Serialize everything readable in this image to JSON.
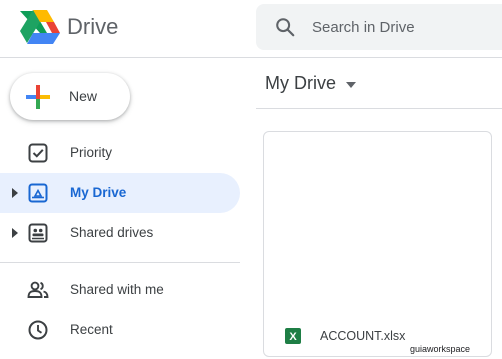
{
  "header": {
    "brand": "Drive",
    "search_placeholder": "Search in Drive"
  },
  "sidebar": {
    "new_label": "New",
    "items": [
      {
        "label": "Priority",
        "icon": "priority-icon",
        "active": false
      },
      {
        "label": "My Drive",
        "icon": "my-drive-icon",
        "active": true
      },
      {
        "label": "Shared drives",
        "icon": "shared-drives-icon",
        "active": false
      },
      {
        "label": "Shared with me",
        "icon": "shared-with-me-icon",
        "active": false
      },
      {
        "label": "Recent",
        "icon": "recent-icon",
        "active": false
      }
    ]
  },
  "main": {
    "title": "My Drive",
    "files": [
      {
        "name": "ACCOUNT.xlsx",
        "type": "excel-icon"
      }
    ]
  },
  "watermark": "guiaworkspace",
  "colors": {
    "active_bg": "#e8f0fe",
    "active_text": "#1967d2",
    "excel_green": "#1e7e45",
    "search_bg": "#f1f3f4"
  }
}
